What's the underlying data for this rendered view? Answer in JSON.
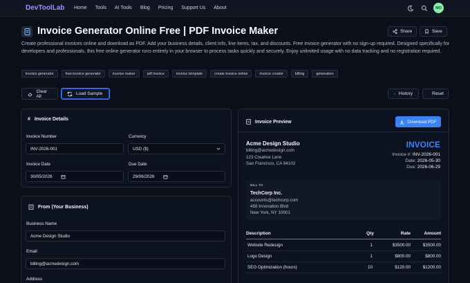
{
  "nav": {
    "logo": "DevToolLab",
    "links": [
      "Home",
      "Tools",
      "AI Tools",
      "Blog",
      "Pricing",
      "Support Us",
      "About"
    ],
    "avatar": "MO"
  },
  "header": {
    "title": "Invoice Generator Online Free | PDF Invoice Maker",
    "share": "Share",
    "save": "Save",
    "description": "Create professional invoices online and download as PDF. Add your business details, client info, line items, tax, and discounts. Free invoice generator with no sign-up required. Designed specifically for developers and professionals, this free online generator runs entirely in your browser to process tasks quickly and securely. Enjoy unlimited usage with no data tracking and no registration required."
  },
  "tags": [
    "invoice generator",
    "free invoice generator",
    "invoice maker",
    "pdf invoice",
    "invoice template",
    "create invoice online",
    "invoice creator",
    "billing",
    "generators"
  ],
  "actions": {
    "clear_all": "Clear All",
    "load_sample": "Load Sample",
    "history": "History",
    "reset": "Reset"
  },
  "details": {
    "title": "Invoice Details",
    "number_label": "Invoice Number",
    "number_value": "INV-2026-001",
    "currency_label": "Currency",
    "currency_value": "USD ($)",
    "date_label": "Invoice Date",
    "date_value": "30/05/2026",
    "due_label": "Due Date",
    "due_value": "29/06/2026"
  },
  "from": {
    "title": "From (Your Business)",
    "name_label": "Business Name",
    "name_value": "Acme Design Studio",
    "email_label": "Email",
    "email_value": "billing@acmedesign.com",
    "address_label": "Address"
  },
  "preview": {
    "title": "Invoice Preview",
    "download": "Download PDF",
    "biz_name": "Acme Design Studio",
    "biz_email": "billing@acmedesign.com",
    "biz_addr1": "123 Creative Lane",
    "biz_addr2": "San Francisco, CA 94102",
    "invoice_word": "INVOICE",
    "inv_no_label": "Invoice #:",
    "inv_no": "INV-2026-001",
    "date_label": "Date:",
    "date": "2026-05-30",
    "due_label": "Due:",
    "due": "2026-06-29",
    "bill_to": "BILL TO",
    "client_name": "TechCorp Inc.",
    "client_email": "accounts@techcorp.com",
    "client_addr1": "456 Innovation Blvd",
    "client_addr2": "New York, NY 10001",
    "columns": [
      "Description",
      "Qty",
      "Rate",
      "Amount"
    ],
    "rows": [
      {
        "desc": "Website Redesign",
        "qty": "1",
        "rate": "$3500.00",
        "amount": "$3500.00"
      },
      {
        "desc": "Logo Design",
        "qty": "1",
        "rate": "$800.00",
        "amount": "$800.00"
      },
      {
        "desc": "SEO Optimization (hours)",
        "qty": "10",
        "rate": "$120.00",
        "amount": "$1200.00"
      }
    ]
  },
  "colors": {
    "accent": "#3b82f6",
    "logo": "#a78bfa",
    "avatar_bg": "#86efac",
    "background": "#0b0f1a"
  }
}
